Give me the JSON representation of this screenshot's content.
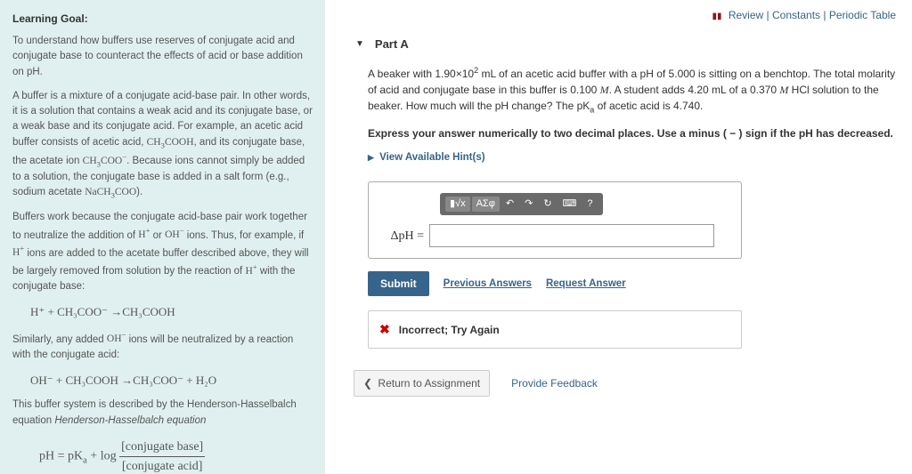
{
  "topbar": {
    "review": "Review",
    "constants": "Constants",
    "periodic": "Periodic Table"
  },
  "sidebar": {
    "heading": "Learning Goal:",
    "intro": "To understand how buffers use reserves of conjugate acid and conjugate base to counteract the effects of acid or base addition on pH.",
    "p1a": "A buffer is a mixture of a conjugate acid-base pair. In other words, it is a solution that contains a weak acid and its conjugate base, or a weak base and its conjugate acid. For example, an acetic acid buffer consists of acetic acid, ",
    "p1b": ", and its conjugate base, the acetate ion ",
    "p1c": ". Because ions cannot simply be added to a solution, the conjugate base is added in a salt form (e.g., sodium acetate ",
    "p1d": ").",
    "p2a": "Buffers work because the conjugate acid-base pair work together to neutralize the addition of ",
    "p2b": " or ",
    "p2c": " ions. Thus, for example, if ",
    "p2d": " ions are added to the acetate buffer described above, they will be largely removed from solution by the reaction of ",
    "p2e": " with the conjugate base:",
    "eq1": "H⁺ + CH₃COO⁻ →CH₃COOH",
    "p3a": "Similarly, any added ",
    "p3b": " ions will be neutralized by a reaction with the conjugate acid:",
    "eq2": "OH⁻ + CH₃COOH →CH₃COO⁻ + H₂O",
    "p4": "This buffer system is described by the Henderson-Hasselbalch equation",
    "hh_lhs": "pH = pK",
    "hh_sub": "a",
    "hh_mid": " + log ",
    "hh_num": "[conjugate base]",
    "hh_den": "[conjugate acid]"
  },
  "part": {
    "label": "Part A",
    "q1a": "A beaker with 1.90×10",
    "q1exp": "2",
    "q1b": " mL of an acetic acid buffer with a pH of 5.000 is sitting on a benchtop. The total molarity of acid and conjugate base in this buffer is 0.100 ",
    "q1c": ". A student adds 4.20 mL of a 0.370 ",
    "q1d": " HCl solution to the beaker. How much will the pH change? The pK",
    "q1sub": "a",
    "q1e": " of acetic acid is 4.740.",
    "M": "M",
    "instr": "Express your answer numerically to two decimal places. Use a minus (  −  ) sign if the pH has decreased.",
    "hints": "View Available Hint(s)",
    "answer_label": "ΔpH =",
    "toolbar": {
      "t1": "▮√x",
      "t2": "ΑΣφ",
      "undo": "↶",
      "redo": "↷",
      "reset": "↻",
      "kbd": "⌨",
      "help": "?"
    },
    "submit": "Submit",
    "prev": "Previous Answers",
    "request": "Request Answer",
    "feedback_icon": "✖",
    "feedback_msg": "Incorrect; Try Again",
    "return": "Return to Assignment",
    "provide": "Provide Feedback"
  }
}
